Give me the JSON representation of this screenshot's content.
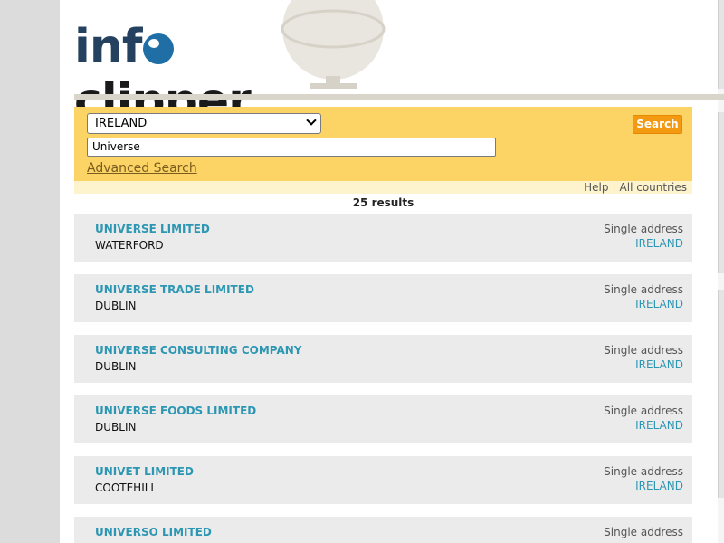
{
  "logo": {
    "part1": "inf",
    "part2": "clipper"
  },
  "search": {
    "country": "IRELAND",
    "query": "Universe",
    "advanced_link": "Advanced Search",
    "button": "Search"
  },
  "links": {
    "help": "Help",
    "separator": "|",
    "all_countries": "All countries"
  },
  "results_count": "25 results",
  "results": [
    {
      "name": "UNIVERSE LIMITED",
      "city": "WATERFORD",
      "address_type": "Single address",
      "country": "IRELAND"
    },
    {
      "name": "UNIVERSE TRADE LIMITED",
      "city": "DUBLIN",
      "address_type": "Single address",
      "country": "IRELAND"
    },
    {
      "name": "UNIVERSE CONSULTING COMPANY",
      "city": "DUBLIN",
      "address_type": "Single address",
      "country": "IRELAND"
    },
    {
      "name": "UNIVERSE FOODS LIMITED",
      "city": "DUBLIN",
      "address_type": "Single address",
      "country": "IRELAND"
    },
    {
      "name": "UNIVET LIMITED",
      "city": "COOTEHILL",
      "address_type": "Single address",
      "country": "IRELAND"
    },
    {
      "name": "UNIVERSO LIMITED",
      "city": "",
      "address_type": "Single address",
      "country": ""
    }
  ],
  "colors": {
    "panel": "#fcd465",
    "button": "#f39a12",
    "link_teal": "#2d97b3",
    "card": "#ebebeb"
  }
}
